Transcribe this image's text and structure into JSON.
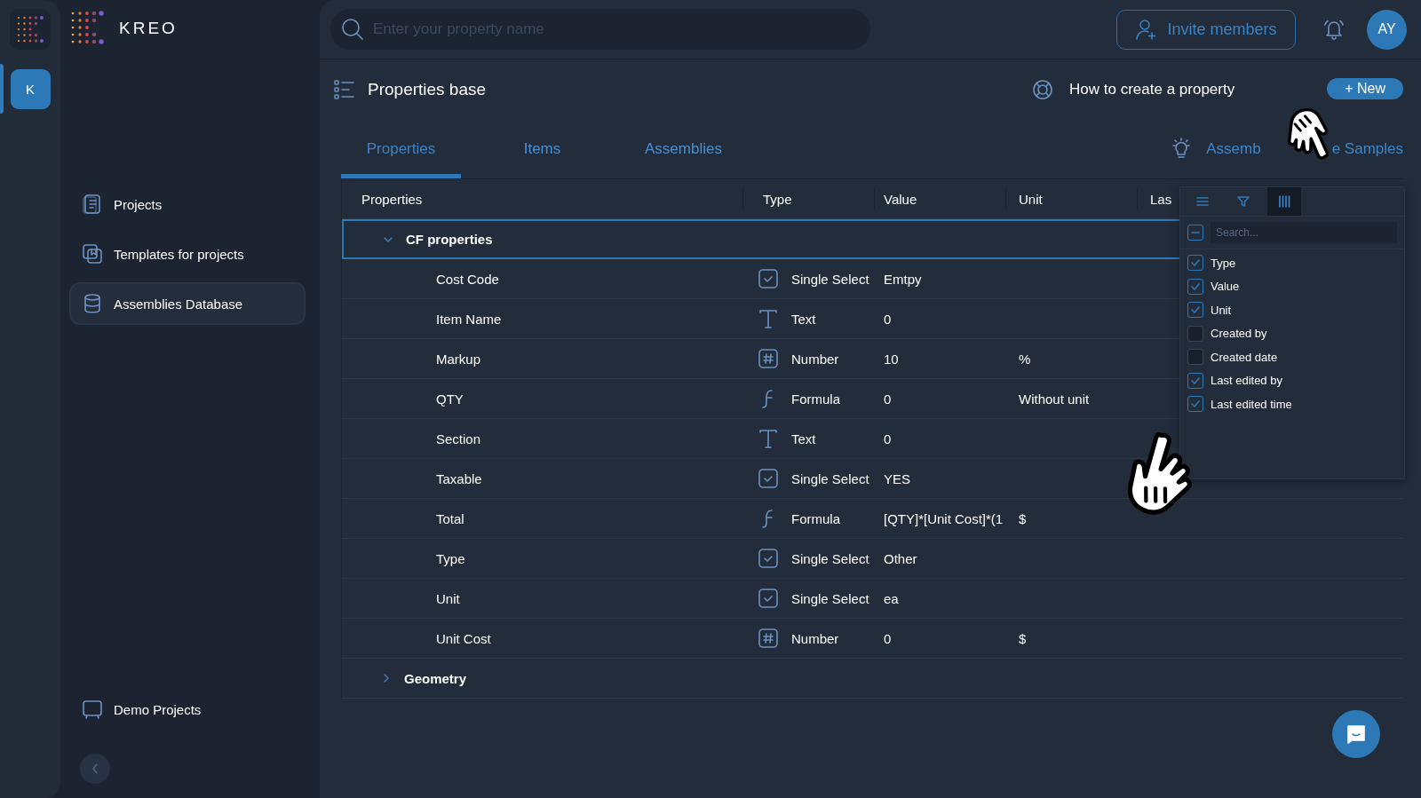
{
  "brand": {
    "name": "KREO"
  },
  "rail": [
    {
      "label": "K",
      "selected": true
    }
  ],
  "sidebar": {
    "items": [
      {
        "kind": "document",
        "label": "Projects",
        "selected": false
      },
      {
        "kind": "template",
        "label": "Templates for projects",
        "selected": false
      },
      {
        "kind": "database",
        "label": "Assemblies Database",
        "selected": true
      }
    ],
    "footer": [
      {
        "kind": "board",
        "label": "Demo Projects"
      }
    ]
  },
  "topbar": {
    "search": {
      "placeholder": "Enter your property name"
    },
    "invite": "Invite members",
    "avatar": "AY"
  },
  "header": {
    "title": "Properties base",
    "help": "How to create a property",
    "new_button": "+ New"
  },
  "tabs": [
    {
      "label": "Properties",
      "selected": true
    },
    {
      "label": "Items",
      "selected": false
    },
    {
      "label": "Assemblies",
      "selected": false
    }
  ],
  "samples_link": [
    "Assemb",
    "e Samples"
  ],
  "table": {
    "columns": [
      "Properties",
      "Type",
      "Value",
      "Unit",
      "Las"
    ],
    "groups": [
      {
        "name": "CF properties",
        "expanded": true,
        "rows": [
          {
            "name": "Cost Code",
            "kind": "select",
            "type": "Single Select",
            "value": "Emtpy"
          },
          {
            "name": "Item Name",
            "kind": "text",
            "type": "Text",
            "value": "0"
          },
          {
            "name": "Markup",
            "kind": "number",
            "type": "Number",
            "value": "10",
            "unit": "%"
          },
          {
            "name": "QTY",
            "kind": "formula",
            "type": "Formula",
            "value": "0",
            "unit": "Without unit"
          },
          {
            "name": "Section",
            "kind": "text",
            "type": "Text",
            "value": "0"
          },
          {
            "name": "Taxable",
            "kind": "select",
            "type": "Single Select",
            "value": "YES"
          },
          {
            "name": "Total",
            "kind": "formula",
            "type": "Formula",
            "value": "[QTY]*[Unit Cost]*(1",
            "unit": "$"
          },
          {
            "name": "Type",
            "kind": "select",
            "type": "Single Select",
            "value": "Other"
          },
          {
            "name": "Unit",
            "kind": "select",
            "type": "Single Select",
            "value": "ea"
          },
          {
            "name": "Unit Cost",
            "kind": "number",
            "type": "Number",
            "value": "0",
            "unit": "$"
          }
        ]
      },
      {
        "name": "Geometry",
        "expanded": false
      }
    ]
  },
  "column_panel": {
    "tabs": [
      {
        "kind": "menu",
        "selected": false
      },
      {
        "kind": "filter",
        "selected": false
      },
      {
        "kind": "columns",
        "selected": true
      }
    ],
    "select_all": {
      "indeterminate": true
    },
    "search": {
      "placeholder": "Search..."
    },
    "columns": [
      {
        "label": "Type",
        "checked": true
      },
      {
        "label": "Value",
        "checked": true
      },
      {
        "label": "Unit",
        "checked": true
      },
      {
        "label": "Created by",
        "checked": false
      },
      {
        "label": "Created date",
        "checked": false
      },
      {
        "label": "Last edited by",
        "checked": true
      },
      {
        "label": "Last edited time",
        "checked": true
      }
    ]
  }
}
